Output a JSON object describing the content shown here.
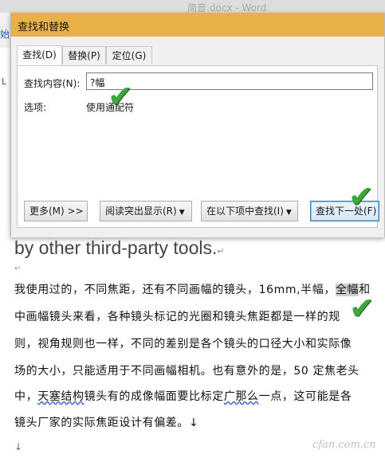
{
  "word": {
    "doc_title": "简音.docx - Word",
    "tab_fragment": "始",
    "ruler_fragment": "L"
  },
  "dialog": {
    "title": "查找和替换",
    "tabs": [
      {
        "label": "查找(D)",
        "active": true
      },
      {
        "label": "替换(P)",
        "active": false
      },
      {
        "label": "定位(G)",
        "active": false
      }
    ],
    "find_label": "查找内容(N):",
    "find_value": "?幅",
    "options_label": "选项:",
    "options_value": "使用通配符",
    "buttons": {
      "more": "更多(M) >>",
      "reading_highlight": "阅读突出显示(R)",
      "find_in": "在以下项中查找(I)",
      "find_next": "查找下一处(F)"
    },
    "dropdown_arrow": "▼"
  },
  "document": {
    "english_line": "by other third-party tools.",
    "para_mark": "↵",
    "small_mark": "↵",
    "lines": {
      "l1_before": "我使用过的，不同焦距，还有不同画幅的镜头，16mm,半幅，",
      "l1_highlight": "全幅",
      "l1_after": "和",
      "l2": "中画幅镜头来看，各种镜头标记的光圈和镜头焦距都是一样的规",
      "l3": "则，视角规则也一样，不同的差别是各个镜头的口径大小和实际像",
      "l4": "场的大小，只能适用于不同画幅相机。也有意外的是，50 定焦老头",
      "l5_before": "中，",
      "l5_wavy1": "天塞结构",
      "l5_mid": "镜头有的成像幅面要比标定",
      "l5_wavy2": "广那么",
      "l5_after": "一点，这可能是各",
      "l6": "镜头厂家的实际焦距设计有偏差。↓"
    },
    "end_mark": "↓",
    "watermark": "cfan.com.cn"
  },
  "annotations": {
    "checkmark_symbol": "✔",
    "checkmark_color": "#3ea63e"
  },
  "colors": {
    "dialog_titlebar": "#e8b046",
    "find_next_border": "#3c7fb1"
  }
}
